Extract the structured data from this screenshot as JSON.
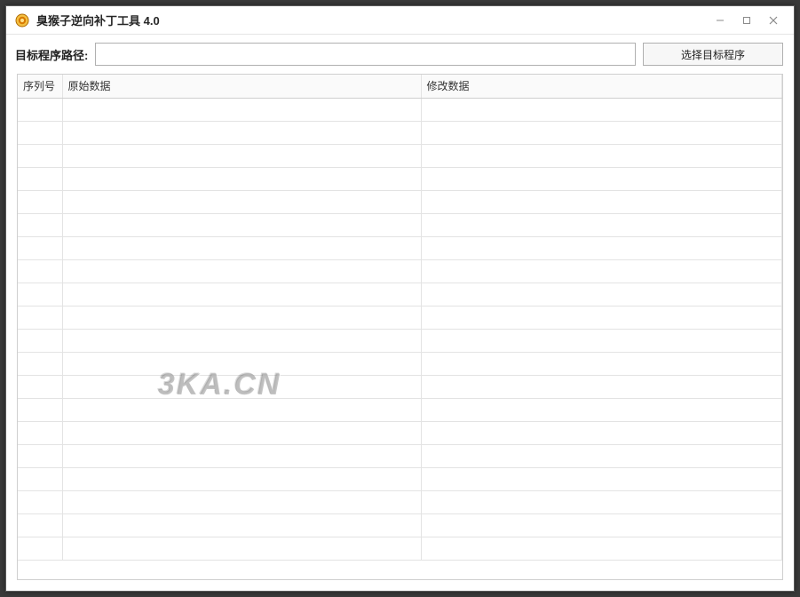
{
  "titlebar": {
    "title": "臭猴子逆向补丁工具 4.0"
  },
  "toolbar": {
    "path_label": "目标程序路径:",
    "path_value": "",
    "browse_label": "选择目标程序"
  },
  "table": {
    "columns": {
      "seq": "序列号",
      "original": "原始数据",
      "modified": "修改数据"
    },
    "rows": [
      {
        "seq": "",
        "original": "",
        "modified": ""
      },
      {
        "seq": "",
        "original": "",
        "modified": ""
      },
      {
        "seq": "",
        "original": "",
        "modified": ""
      },
      {
        "seq": "",
        "original": "",
        "modified": ""
      },
      {
        "seq": "",
        "original": "",
        "modified": ""
      },
      {
        "seq": "",
        "original": "",
        "modified": ""
      },
      {
        "seq": "",
        "original": "",
        "modified": ""
      },
      {
        "seq": "",
        "original": "",
        "modified": ""
      },
      {
        "seq": "",
        "original": "",
        "modified": ""
      },
      {
        "seq": "",
        "original": "",
        "modified": ""
      },
      {
        "seq": "",
        "original": "",
        "modified": ""
      },
      {
        "seq": "",
        "original": "",
        "modified": ""
      },
      {
        "seq": "",
        "original": "",
        "modified": ""
      },
      {
        "seq": "",
        "original": "",
        "modified": ""
      },
      {
        "seq": "",
        "original": "",
        "modified": ""
      },
      {
        "seq": "",
        "original": "",
        "modified": ""
      },
      {
        "seq": "",
        "original": "",
        "modified": ""
      },
      {
        "seq": "",
        "original": "",
        "modified": ""
      },
      {
        "seq": "",
        "original": "",
        "modified": ""
      },
      {
        "seq": "",
        "original": "",
        "modified": ""
      }
    ]
  },
  "watermark": "3KA.CN"
}
